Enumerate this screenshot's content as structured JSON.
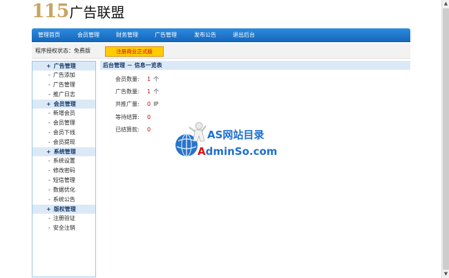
{
  "logo": {
    "number": "115",
    "text": "广告联盟"
  },
  "nav": {
    "items": [
      "管理首页",
      "会员管理",
      "财务管理",
      "广告管理",
      "发布公告",
      "退出后台"
    ]
  },
  "status": {
    "label": "程序授权状态：免费版",
    "upgrade_button": "注册商业正式版"
  },
  "sidebar": {
    "sections": [
      {
        "title": "广告管理",
        "items": [
          "广告添加",
          "广告管理",
          "推广日志"
        ]
      },
      {
        "title": "会员管理",
        "items": [
          "新增会员",
          "会员管理",
          "会员下线",
          "会员提现"
        ]
      },
      {
        "title": "系统管理",
        "items": [
          "系统设置",
          "修改密码",
          "短信管理",
          "数据优化",
          "系统公告"
        ]
      },
      {
        "title": "版权管理",
        "items": [
          "注册验证",
          "安全注销"
        ]
      }
    ]
  },
  "main": {
    "title": "后台管理 － 信息一览表",
    "stats": [
      {
        "label": "会员数量:",
        "value": "1",
        "unit": "个"
      },
      {
        "label": "广告数量:",
        "value": "1",
        "unit": "个"
      },
      {
        "label": "共推广量:",
        "value": "0",
        "unit": "IP"
      },
      {
        "label": "等待结算:",
        "value": "0",
        "unit": ""
      },
      {
        "label": "已结算款:",
        "value": "0",
        "unit": ""
      }
    ]
  },
  "watermark": {
    "line1": "AS网站目录",
    "line2_red": "A",
    "line2_rest": "dminSo.com"
  },
  "colors": {
    "nav_blue": "#1a78d0",
    "section_bg": "#dbe9f7",
    "value_red": "#cc0000",
    "button_yellow": "#ffcc00"
  }
}
